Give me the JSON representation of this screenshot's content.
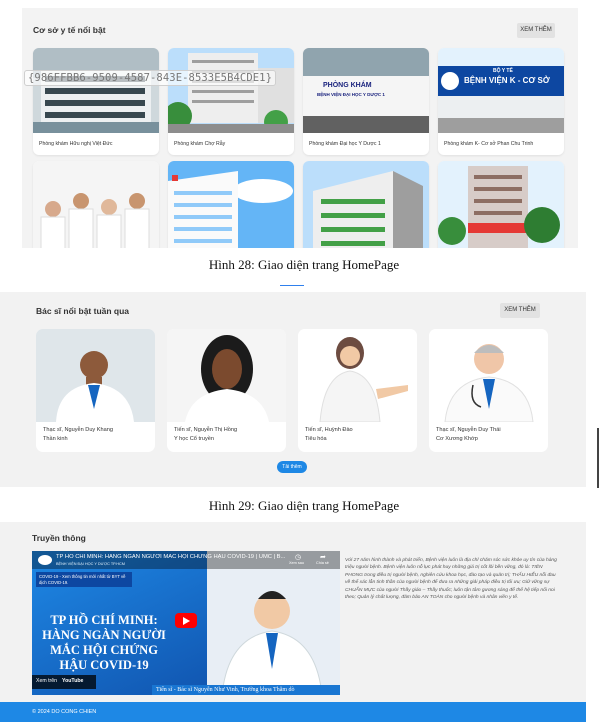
{
  "facilities": {
    "title": "Cơ sở y tế nổi bật",
    "more_label": "XEM THÊM",
    "items": [
      {
        "name": "Phòng khám Hữu nghị Việt Đức"
      },
      {
        "name": "Phòng khám Chợ Rẫy"
      },
      {
        "name": "Phòng khám Đại học Y Dược 1"
      },
      {
        "name": "Phòng khám K- Cơ sở Phan Chu Trinh"
      }
    ],
    "sign_text": "PHÒNG KHÁM",
    "sign_sub": "BỆNH VIỆN ĐẠI HỌC Y DƯỢC 1",
    "k_sign_top": "BỘ Y TẾ",
    "k_sign": "BỆNH VIỆN K - CƠ SỞ"
  },
  "overlay_id": "{986FFBB6-9509-4587-843E-8533E5B4CDE1}",
  "captions": {
    "fig28": "Hình 28: Giao diện trang HomePage",
    "fig29": "Hình 29: Giao diện trang HomePage"
  },
  "doctors": {
    "title": "Bác sĩ nổi bật tuần qua",
    "more_label": "XEM THÊM",
    "view_label": "Tải thêm",
    "items": [
      {
        "name": "Thạc sĩ, Nguyễn Duy Khang",
        "specialty": "Thần kinh"
      },
      {
        "name": "Tiến sĩ, Nguyễn Thị Hồng",
        "specialty": "Y học Cổ truyền"
      },
      {
        "name": "Tiến sĩ, Huỳnh Đào",
        "specialty": "Tiêu hóa"
      },
      {
        "name": "Thạc sĩ, Nguyễn Duy Thái",
        "specialty": "Cơ Xương Khớp"
      }
    ]
  },
  "media": {
    "title": "Truyền thông",
    "video_title": "TP HỒ CHÍ MINH: HÀNG NGÀN NGƯỜI MẮC HỘI CHỨNG HẬU COVID-19 | UMC | B...",
    "video_channel": "BỆNH VIỆN ĐẠI HỌC Y DƯỢC TP.HCM",
    "video_small_note": "COVID-19 - Xem thông tin mới nhất từ BYT về dịch COVID-19.",
    "share_label": "Chia sẻ",
    "watch_later_label": "Xem sau",
    "headline": "TP HỒ CHÍ MINH: HÀNG NGÀN NGƯỜI MẮC HỘI CHỨNG HẬU COVID-19",
    "watch_on": "Xem trên",
    "youtube": "YouTube",
    "lower_third": "Tiến sĩ - Bác sĩ Nguyễn Như Vinh, Trưởng khoa Thăm dò",
    "description": "Với 27 năm hình thành và phát triển, Bệnh viện luôn là địa chỉ chăm sóc sức khỏe uy tín của hàng triệu người bệnh. Bệnh viện luôn nỗ lực phát huy những giá trị cốt lõi bền vững, đó là: TIÊN PHONG trong điều trị người bệnh, nghiên cứu khoa học, đào tạo và quản trị; THẤU HIỂU nỗi đau về thể xác lẫn tinh thần của người bệnh để đưa ra những giải pháp điều trị tối ưu; Giữ vững sự CHUẨN MỰC của người Thầy giáo – Thầy thuốc; luôn tận tâm gương sáng để thế hệ tiếp nối noi theo; Quản lý chất lượng, đảm bảo AN TOÀN cho người bệnh và nhân viên y tế."
  },
  "footer": {
    "text": "© 2024 DO CONG CHIEN"
  },
  "colors": {
    "accent": "#1e88e5",
    "section_bg": "#f2f2f2",
    "youtube_red": "#ff0000"
  }
}
